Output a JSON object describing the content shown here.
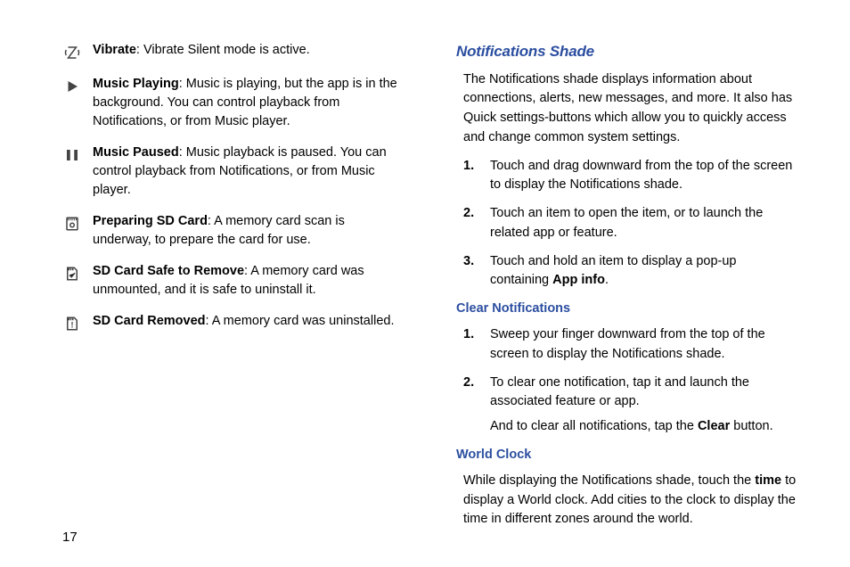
{
  "page_number": "17",
  "left": {
    "items": [
      {
        "icon": "vibrate",
        "title": "Vibrate",
        "text": ": Vibrate Silent mode is active."
      },
      {
        "icon": "play",
        "title": "Music Playing",
        "text": ": Music is playing, but the app is in the background. You can control playback from Notifications, or from Music player."
      },
      {
        "icon": "pause",
        "title": "Music Paused",
        "text": ": Music playback is paused. You can control playback from Notifications, or from Music player."
      },
      {
        "icon": "sd-prep",
        "title": "Preparing SD Card",
        "text": ": A memory card scan is underway, to prepare the card for use."
      },
      {
        "icon": "sd-safe",
        "title": "SD Card Safe to Remove",
        "text": ": A memory card was unmounted, and it is safe to uninstall it."
      },
      {
        "icon": "sd-removed",
        "title": "SD Card Removed",
        "text": ": A memory card was uninstalled."
      }
    ]
  },
  "right": {
    "h2": "Notifications Shade",
    "intro": "The Notifications shade displays information about connections, alerts, new messages, and more. It also has Quick settings-buttons which allow you to quickly access and change common system settings.",
    "steps1": [
      {
        "t": "Touch and drag downward from the top of the screen to display the Notifications shade."
      },
      {
        "t": "Touch an item to open the item, or to launch the related app or feature."
      },
      {
        "t_pre": "Touch and hold an item to display a pop-up containing ",
        "bold": "App info",
        "t_post": "."
      }
    ],
    "h3a": "Clear Notifications",
    "steps2": [
      {
        "t": "Sweep your finger downward from the top of the screen to display the Notifications shade."
      },
      {
        "t": "To clear one notification, tap it and launch the associated feature or app."
      }
    ],
    "clear_cont_pre": "And to clear all notifications, tap the ",
    "clear_bold": "Clear",
    "clear_cont_post": " button.",
    "h3b": "World Clock",
    "world_pre": "While displaying the Notifications shade, touch the ",
    "world_bold": "time",
    "world_post": " to display a World clock. Add cities to the clock to display the time in different zones around the world."
  }
}
